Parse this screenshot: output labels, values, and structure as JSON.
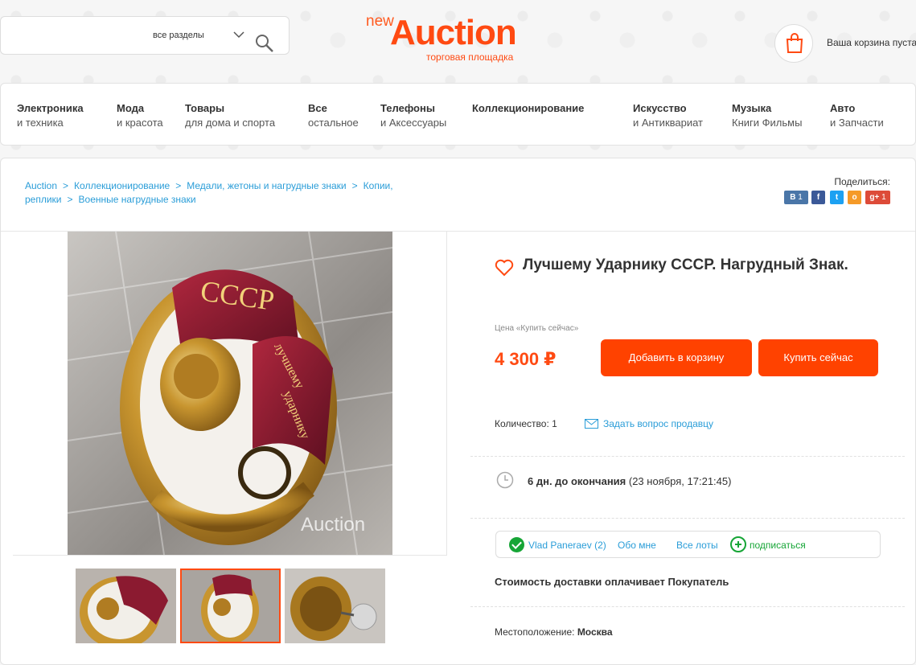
{
  "header": {
    "search_section": "все разделы",
    "logo_new": "new",
    "logo_auction": "Auction",
    "logo_sub": "торговая площадка",
    "cart_text": "Ваша корзина пуста"
  },
  "categories": [
    {
      "line1": "Электроника",
      "line2": "и техника"
    },
    {
      "line1": "Мода",
      "line2": "и красота"
    },
    {
      "line1": "Товары",
      "line2": "для дома и спорта"
    },
    {
      "line1": "Все",
      "line2": "остальное"
    },
    {
      "line1": "Телефоны",
      "line2": "и Аксессуары"
    },
    {
      "line1": "Коллекционирование",
      "line2": ""
    },
    {
      "line1": "Искусство",
      "line2": "и Антиквариат"
    },
    {
      "line1": "Музыка",
      "line2": "Книги Фильмы"
    },
    {
      "line1": "Авто",
      "line2": "и Запчасти"
    }
  ],
  "breadcrumbs": [
    "Auction",
    "Коллекционирование",
    "Медали, жетоны и нагрудные знаки",
    "Копии, реплики",
    "Военные нагрудные знаки"
  ],
  "share": {
    "label": "Поделиться:",
    "vk": "В",
    "vk_count": "1",
    "fb": "f",
    "tw": "t",
    "ok": "o",
    "gp": "g+",
    "gp_count": "1"
  },
  "product": {
    "title": "Лучшему Ударнику СССР. Нагрудный Знак.",
    "price_label": "Цена «Купить сейчас»",
    "price": "4 300 ₽",
    "add_to_cart": "Добавить в корзину",
    "buy_now": "Купить сейчас",
    "quantity_label": "Количество:",
    "quantity": "1",
    "ask_seller": "Задать вопрос продавцу",
    "ends_in": "6 дн. до окончания",
    "ends_at": "(23 ноября, 17:21:45)",
    "shipping": "Стоимость доставки оплачивает Покупатель",
    "location_label": "Местоположение:",
    "location": "Москва"
  },
  "image": {
    "badge_text_top": "СССР",
    "badge_text_mid": "лучшему",
    "badge_text_bottom": "ударнику",
    "watermark": "Auction"
  },
  "seller": {
    "name": "Vlad Paneraev",
    "rating": "(2)",
    "about": "Обо мне",
    "all_lots": "Все лоты",
    "subscribe": "подписаться"
  },
  "colors": {
    "accent": "#ff4200",
    "link": "#2a9dd8",
    "verified": "#16a536"
  }
}
